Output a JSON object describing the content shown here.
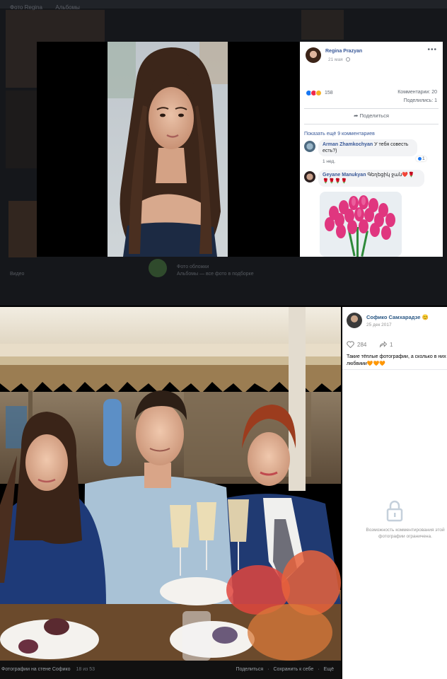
{
  "fb_viewer": {
    "background_tabs": [
      "Фото Regina",
      "Альбомы"
    ],
    "background_captions": [
      "Видео",
      "Фото обложки",
      "Альбомы — все фото в подборке"
    ],
    "post": {
      "author": "Regina Prazyan",
      "date": "21 мая",
      "more_icon": "more-dots-icon"
    },
    "reactions": {
      "count": "158",
      "types": [
        "like",
        "love",
        "haha"
      ]
    },
    "comments_count": "Комментарии: 20",
    "shares_count": "Поделились: 1",
    "share_button": "Поделиться",
    "more_comments": "Показать ещё 9 комментариев",
    "comments": [
      {
        "author": "Arman Zhamkochyan",
        "text": "У тебя совесть есть?)",
        "likes": "1",
        "reply": "1 нед."
      },
      {
        "author": "Geyane Manukyan",
        "text": "Գեղեցիկ ջան❤️🌹🌹🌹🌹🌹"
      }
    ]
  },
  "vk_viewer": {
    "author": "Софико Самхарадзе 😊",
    "date": "25 дек 2017",
    "likes": "284",
    "reposts": "1",
    "caption": "Такие тёплые фотографии, а сколько в них любвиии",
    "caption_hearts": "🧡🧡🧡",
    "comments_restricted": "Возможность комментирования этой фотографии ограничена.",
    "bottom_bar": {
      "album": "Фотографии на стене Софико",
      "counter": "18 из 53",
      "links": [
        "Поделиться",
        "Сохранить к себе",
        "Ещё"
      ]
    }
  },
  "colors": {
    "fb_link": "#385898",
    "vk_link": "#2a5885",
    "vk_hearts": "#ff5c1a",
    "fb_like": "#1877f2",
    "fb_love": "#f0284a",
    "fb_haha": "#f7b125"
  }
}
